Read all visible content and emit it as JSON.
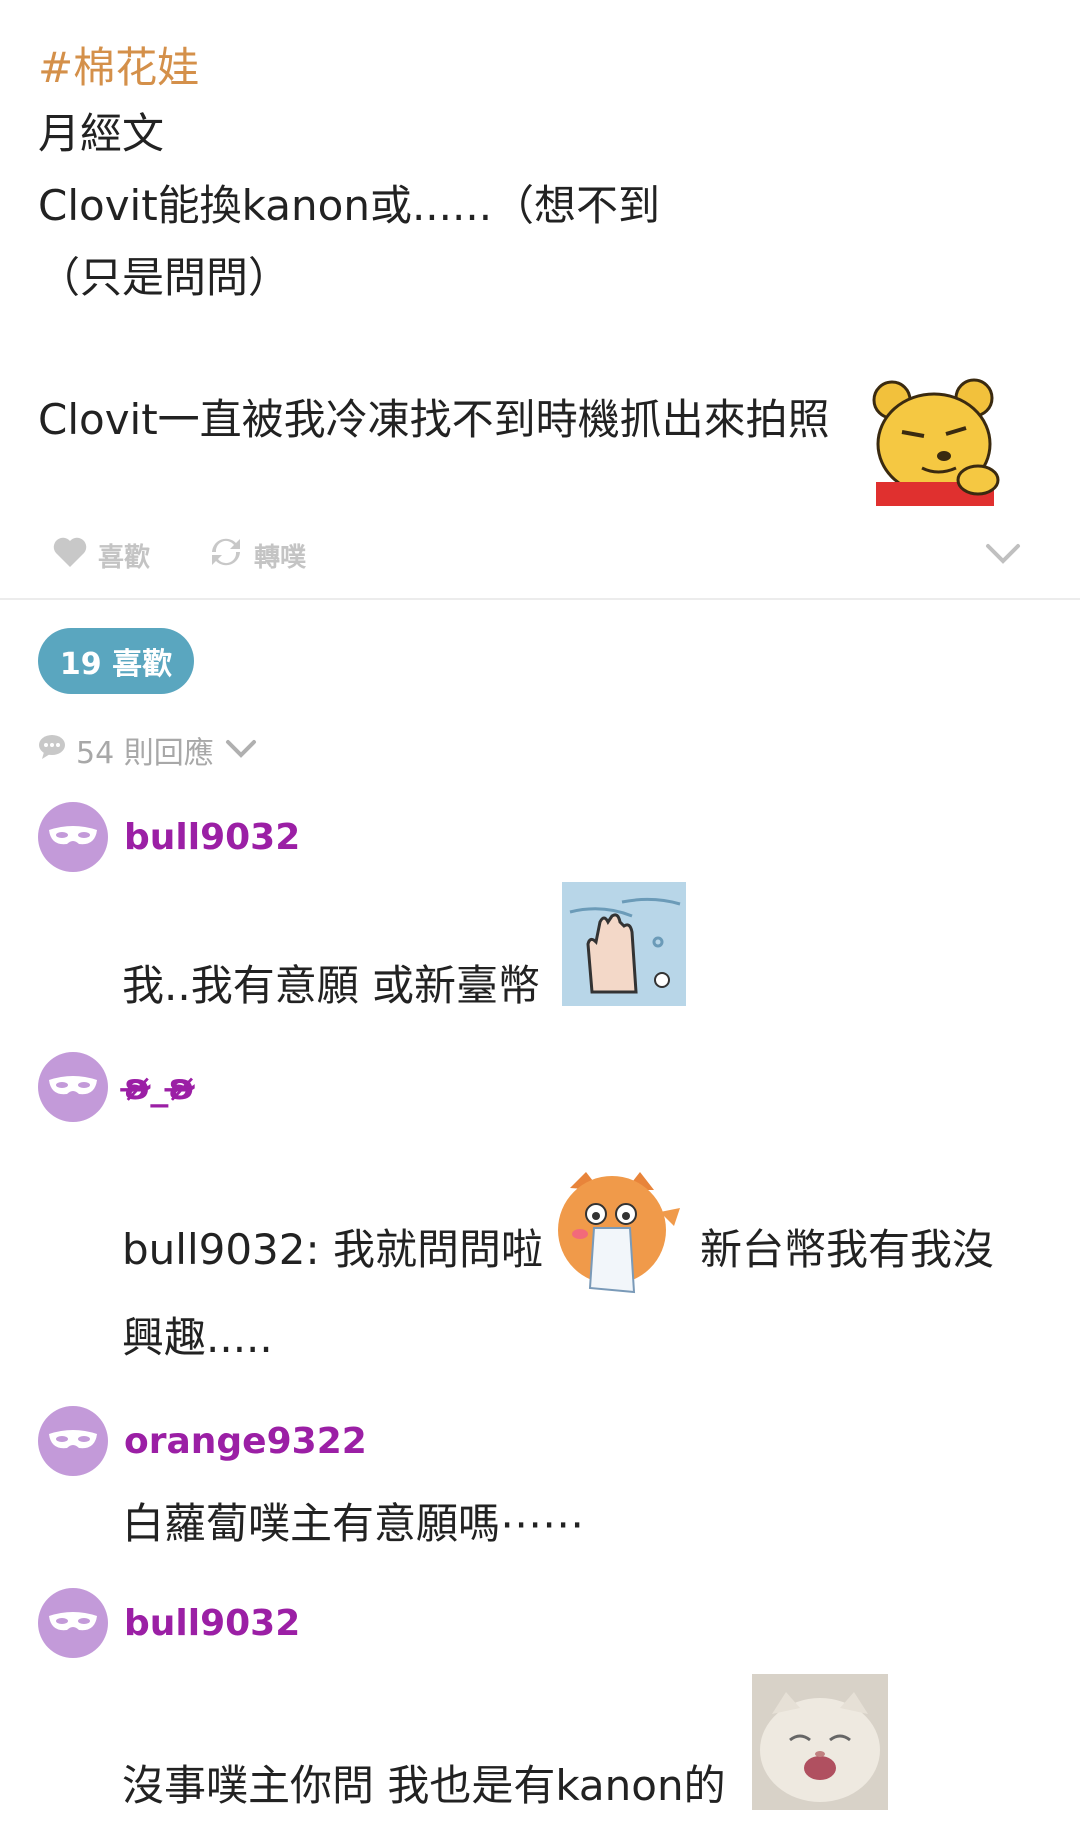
{
  "post": {
    "hashtag": "#棉花娃",
    "line1": "月經文",
    "line2": "Clovit能換kanon或......（想不到",
    "line3": "（只是問問）",
    "line4": "Clovit一直被我冷凍找不到時機抓出來拍照",
    "sticker": "pooh-sticker"
  },
  "actions": {
    "like_label": "喜歡",
    "replurk_label": "轉噗",
    "more_icon": "chevron-down-icon"
  },
  "stats": {
    "likes_badge": "19 喜歡",
    "replies_label": "54 則回應"
  },
  "comments": [
    {
      "user": "bull9032",
      "text": "我..我有意願 或新臺幣",
      "sticker": "hand-in-water-sticker"
    },
    {
      "user": "ʚ̴̶̷̷_ʚ̴̶̷̷",
      "text_a": "bull9032: 我就問問啦",
      "text_b": "新台幣我有我沒",
      "text_c": "興趣.....",
      "sticker": "crying-fox-sticker"
    },
    {
      "user": "orange9322",
      "text": "白蘿蔔噗主有意願嗎⋯⋯"
    },
    {
      "user": "bull9032",
      "text": "沒事噗主你問 我也是有kanon的",
      "sticker": "laughing-cat-sticker"
    }
  ],
  "colors": {
    "hashtag": "#d4904a",
    "username": "#9b1fa5",
    "avatar": "#c39ad9",
    "likes_pill": "#5aa6bf"
  }
}
